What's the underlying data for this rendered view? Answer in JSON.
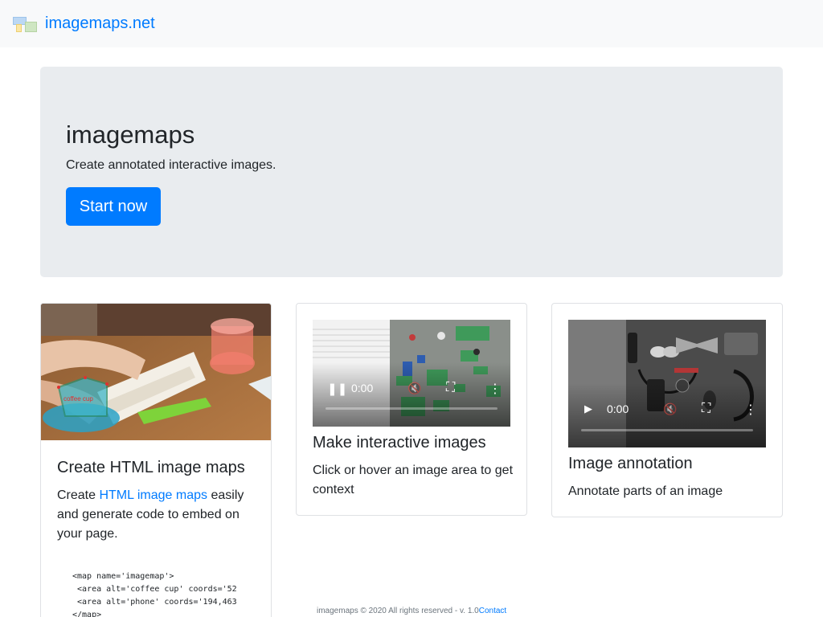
{
  "navbar": {
    "brand": "imagemaps.net",
    "logo_icon": "imagemaps-logo-icon"
  },
  "hero": {
    "title": "imagemaps",
    "lead": "Create annotated interactive images.",
    "button": "Start now"
  },
  "cards": [
    {
      "title": "Create HTML image maps",
      "text_before": "Create ",
      "link": "HTML image maps",
      "text_after": " easily and generate code to embed on your page.",
      "image_label": "coffee cup",
      "code": [
        "<map name='imagemap'>",
        " <area alt='coffee cup' coords='52",
        " <area alt='phone' coords='194,463",
        "</map>"
      ]
    },
    {
      "title": "Make interactive images",
      "text": "Click or hover an image area to get context",
      "video": {
        "time": "0:00",
        "state": "playing",
        "progress": 0.0
      }
    },
    {
      "title": "Image annotation",
      "text": "Annotate parts of an image",
      "video": {
        "time": "0:00",
        "state": "paused",
        "progress": 0.0
      }
    }
  ],
  "footer": {
    "text": "imagemaps © 2020 All rights reserved - v. 1.0",
    "link": "Contact"
  },
  "colors": {
    "primary": "#007bff",
    "jumbotron": "#e9ecef",
    "navbar": "#f8f9fa"
  }
}
